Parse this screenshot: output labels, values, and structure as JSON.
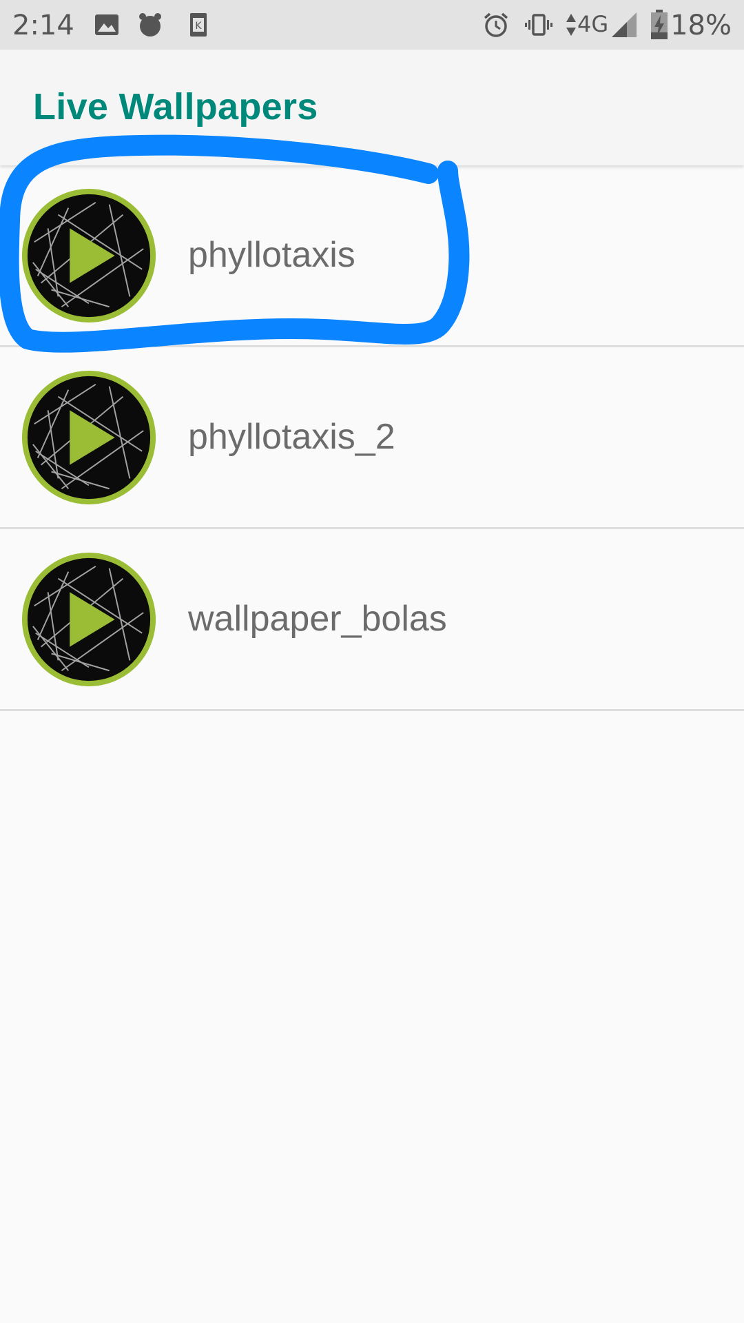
{
  "status_bar": {
    "time": "2:14",
    "network": "4G",
    "battery": "18%",
    "icons": [
      "image-icon",
      "alarm-app-icon",
      "k-app-icon",
      "alarm-clock-icon",
      "vibrate-icon",
      "data-arrows-icon",
      "signal-icon",
      "battery-charging-icon"
    ]
  },
  "toolbar": {
    "title": "Live Wallpapers",
    "title_color": "#00897b"
  },
  "wallpapers": [
    {
      "label": "phyllotaxis",
      "icon": "live-wallpaper-play-icon"
    },
    {
      "label": "phyllotaxis_2",
      "icon": "live-wallpaper-play-icon"
    },
    {
      "label": "wallpaper_bolas",
      "icon": "live-wallpaper-play-icon"
    }
  ],
  "colors": {
    "accent_green": "#9bbd36",
    "highlight_stroke": "#0a84ff"
  }
}
